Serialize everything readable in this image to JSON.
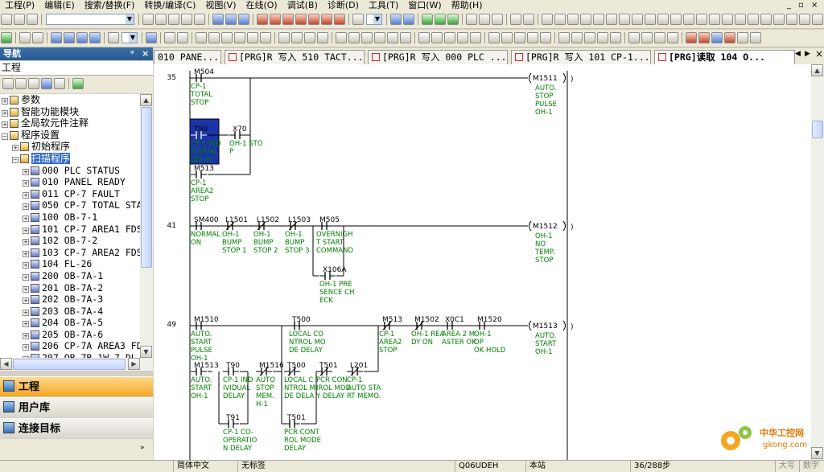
{
  "menu": {
    "items": [
      "工程(P)",
      "编辑(E)",
      "搜索/替换(F)",
      "转换/编译(C)",
      "视图(V)",
      "在线(O)",
      "调试(B)",
      "诊断(D)",
      "工具(T)",
      "窗口(W)",
      "帮助(H)"
    ]
  },
  "nav": {
    "title": "导航",
    "pin": "ᵠ",
    "close": "×",
    "project_header": "工程"
  },
  "tree": {
    "items": [
      {
        "label": "参数",
        "sel": false
      },
      {
        "label": "智能功能模块",
        "sel": false
      },
      {
        "label": "全局软元件注释",
        "sel": false
      },
      {
        "label": "程序设置",
        "sel": false
      },
      {
        "label": "初始程序",
        "sel": false
      },
      {
        "label": "扫描程序",
        "sel": true
      },
      {
        "label": "000 PLC STATUS",
        "sel": false
      },
      {
        "label": "010 PANEL READY",
        "sel": false
      },
      {
        "label": "011 CP-7 FAULT",
        "sel": false
      },
      {
        "label": "050 CP-7 TOTAL STA",
        "sel": false
      },
      {
        "label": "100 OB-7-1",
        "sel": false
      },
      {
        "label": "101 CP-7 AREA1 FDS",
        "sel": false
      },
      {
        "label": "102 OB-7-2",
        "sel": false
      },
      {
        "label": "103 CP-7 AREA2 FDS",
        "sel": false
      },
      {
        "label": "104 FL-26",
        "sel": false
      },
      {
        "label": "200 OB-7A-1",
        "sel": false
      },
      {
        "label": "201 OB-7A-2",
        "sel": false
      },
      {
        "label": "202 OB-7A-3",
        "sel": false
      },
      {
        "label": "203 OB-7A-4",
        "sel": false
      },
      {
        "label": "204 OB-7A-5",
        "sel": false
      },
      {
        "label": "205 OB-7A-6",
        "sel": false
      },
      {
        "label": "206 CP-7A AREA3 FD",
        "sel": false
      },
      {
        "label": "207 OB-7B-1W-7-DL",
        "sel": false
      }
    ]
  },
  "panels": {
    "project": "工程",
    "user_lib": "用户库",
    "connect": "连接目标"
  },
  "tabs": [
    {
      "label": "010 PANE...",
      "active": false
    },
    {
      "label": "[PRG]R 写入 510 TACT...",
      "active": false
    },
    {
      "label": "[PRG]R 写入 000 PLC ...",
      "active": false
    },
    {
      "label": "[PRG]R 写入 101 CP-1...",
      "active": false
    },
    {
      "label": "[PRG]读取 104 O...",
      "active": true
    }
  ],
  "ladder": {
    "rung_steps": [
      "35",
      "41",
      "49"
    ],
    "contacts": {
      "r35_m504": {
        "dev": "M504",
        "cmt": [
          "CP-1",
          "TOTAL",
          "STOP"
        ]
      },
      "r35_t90": {
        "dev": "T90",
        "cmt": [
          "CP-1 IND",
          "IVIDUAL",
          "DELAY"
        ]
      },
      "r35_x70": {
        "dev": "X70",
        "cmt": [
          "OH-1 STO",
          "P"
        ]
      },
      "r35_m513": {
        "dev": "M513",
        "cmt": [
          "CP-1",
          "AREA2",
          "STOP"
        ]
      },
      "r41_sm400": {
        "dev": "SM400",
        "cmt": [
          "NORMAL",
          "ON"
        ]
      },
      "r41_l1501": {
        "dev": "L1501",
        "cmt": [
          "OH-1",
          "BUMP",
          "STOP 1"
        ]
      },
      "r41_l1502": {
        "dev": "L1502",
        "cmt": [
          "OH-1",
          "BUMP",
          "STOP 2"
        ]
      },
      "r41_l1503": {
        "dev": "L1503",
        "cmt": [
          "OH-1",
          "BUMP",
          "STOP 3"
        ]
      },
      "r41_m505": {
        "dev": "M505",
        "cmt": [
          "OVERNIGH",
          "T START",
          "COMMAND"
        ]
      },
      "r41_x106a": {
        "dev": "X106A",
        "cmt": [
          "OH-1 PRE",
          "SENCE CH",
          "ECK"
        ]
      },
      "r49_m1510": {
        "dev": "M1510",
        "cmt": [
          "AUTO.",
          "START",
          "PULSE",
          "OH-1"
        ]
      },
      "r49_t500a": {
        "dev": "T500",
        "cmt": [
          "LOCAL CO",
          "NTROL MO",
          "DE DELAY"
        ]
      },
      "r49_m513": {
        "dev": "M513",
        "cmt": [
          "CP-1",
          "AREA2",
          "STOP"
        ]
      },
      "r49_m1502": {
        "dev": "M1502",
        "cmt": [
          "OH-1 REA",
          "DY ON"
        ]
      },
      "r49_x0c1": {
        "dev": "X0C1",
        "cmt": [
          "AREA 2 M",
          "ASTER OK"
        ]
      },
      "r49_m1520": {
        "dev": "M1520",
        "cmt": [
          "OH-1",
          "OP",
          "OK HOLD"
        ]
      },
      "r49_m1513": {
        "dev": "M1513",
        "cmt": [
          "AUTO.",
          "START",
          "OH-1"
        ]
      },
      "r49_t90": {
        "dev": "T90",
        "cmt": [
          "CP-1 IND",
          "IVIDUAL",
          "DELAY"
        ]
      },
      "r49_m1516": {
        "dev": "M1516",
        "cmt": [
          "AUTO",
          "STOP",
          "MEM.",
          "H-1"
        ]
      },
      "r49_t500b": {
        "dev": "T500",
        "cmt": [
          "LOCAL C",
          "NTROL M",
          "DE DELA"
        ]
      },
      "r49_t501a": {
        "dev": "T501",
        "cmt": [
          "PCR CON",
          "IROL MOD",
          "Y DELAY"
        ]
      },
      "r49_l201": {
        "dev": "L201",
        "cmt": [
          "CP-1",
          "AUTO STA",
          "RT MEMO."
        ]
      },
      "r49_t91": {
        "dev": "T91",
        "cmt": [
          "CP-1 CO-",
          "OPERATIO",
          "N DELAY"
        ]
      },
      "r49_t501b": {
        "dev": "T501",
        "cmt": [
          "PCR CONT",
          "ROL MODE",
          "DELAY"
        ]
      }
    },
    "coils": {
      "c35": {
        "dev": "M1511",
        "cmt": [
          "AUTO.",
          "STOP",
          "PULSE",
          "OH-1"
        ]
      },
      "c41": {
        "dev": "M1512",
        "cmt": [
          "OH-1",
          "NO",
          "TEMP.",
          "STOP"
        ]
      },
      "c49": {
        "dev": "M1513",
        "cmt": [
          "AUTO.",
          "START",
          "OH-1"
        ]
      }
    }
  },
  "status": {
    "lang": "简体中文",
    "label": "无标签",
    "cpu": "Q06UDEH",
    "station": "本站",
    "steps": "36/288步",
    "caps": "大写",
    "num": "数字"
  },
  "watermark": {
    "site_cn": "中华工控网",
    "site_en": "gkong.com"
  }
}
